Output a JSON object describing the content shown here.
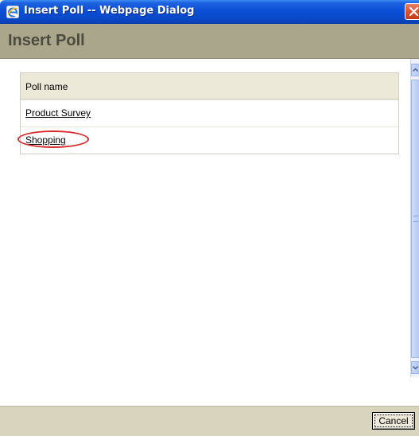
{
  "window": {
    "title": "Insert Poll -- Webpage Dialog"
  },
  "header": {
    "title": "Insert Poll"
  },
  "poll_table": {
    "column_header": "Poll name",
    "rows": [
      {
        "label": "Product Survey"
      },
      {
        "label": "Shopping",
        "highlighted": true
      }
    ]
  },
  "footer": {
    "cancel_label": "Cancel"
  },
  "colors": {
    "header_band": "#a9a68c",
    "footer_band": "#d8d4bd",
    "highlight_ring": "#d8282a",
    "titlebar": "#0a4fd6"
  },
  "icons": {
    "title": "internet-explorer-icon",
    "close": "close-icon"
  }
}
